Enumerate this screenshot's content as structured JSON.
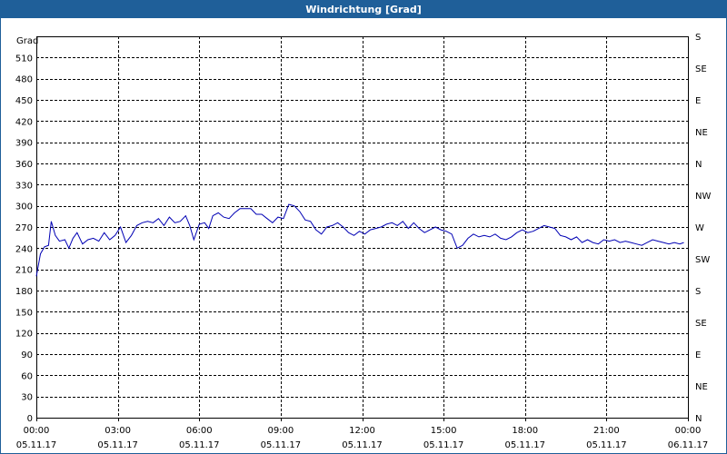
{
  "chart_data": {
    "type": "line",
    "title": "Windrichtung [Grad]",
    "ylabel": "Grad",
    "ylim": [
      0,
      540
    ],
    "yticks": [
      0,
      30,
      60,
      90,
      120,
      150,
      180,
      210,
      240,
      270,
      300,
      330,
      360,
      390,
      420,
      450,
      480,
      510
    ],
    "right_axis_labels": [
      "N",
      "NE",
      "E",
      "SE",
      "S",
      "SW",
      "W",
      "NW",
      "N",
      "NE",
      "E",
      "SE",
      "S"
    ],
    "x_tick_labels": [
      {
        "time": "00:00",
        "date": "05.11.17"
      },
      {
        "time": "03:00",
        "date": "05.11.17"
      },
      {
        "time": "06:00",
        "date": "05.11.17"
      },
      {
        "time": "09:00",
        "date": "05.11.17"
      },
      {
        "time": "12:00",
        "date": "05.11.17"
      },
      {
        "time": "15:00",
        "date": "05.11.17"
      },
      {
        "time": "18:00",
        "date": "05.11.17"
      },
      {
        "time": "21:00",
        "date": "05.11.17"
      },
      {
        "time": "00:00",
        "date": "06.11.17"
      }
    ],
    "xlim_hours": [
      0,
      24
    ],
    "grid": true,
    "series": [
      {
        "color": "#0000b4",
        "points": [
          [
            0.0,
            200
          ],
          [
            0.15,
            232
          ],
          [
            0.3,
            242
          ],
          [
            0.45,
            244
          ],
          [
            0.55,
            278
          ],
          [
            0.7,
            258
          ],
          [
            0.85,
            250
          ],
          [
            1.05,
            252
          ],
          [
            1.2,
            240
          ],
          [
            1.35,
            254
          ],
          [
            1.5,
            262
          ],
          [
            1.7,
            246
          ],
          [
            1.9,
            252
          ],
          [
            2.1,
            254
          ],
          [
            2.3,
            250
          ],
          [
            2.5,
            262
          ],
          [
            2.7,
            252
          ],
          [
            2.9,
            258
          ],
          [
            3.1,
            270
          ],
          [
            3.3,
            248
          ],
          [
            3.5,
            258
          ],
          [
            3.7,
            272
          ],
          [
            3.9,
            276
          ],
          [
            4.1,
            278
          ],
          [
            4.3,
            276
          ],
          [
            4.5,
            282
          ],
          [
            4.7,
            272
          ],
          [
            4.9,
            284
          ],
          [
            5.1,
            276
          ],
          [
            5.3,
            278
          ],
          [
            5.5,
            286
          ],
          [
            5.65,
            272
          ],
          [
            5.8,
            252
          ],
          [
            6.0,
            274
          ],
          [
            6.2,
            276
          ],
          [
            6.35,
            268
          ],
          [
            6.5,
            286
          ],
          [
            6.7,
            290
          ],
          [
            6.9,
            284
          ],
          [
            7.1,
            282
          ],
          [
            7.3,
            290
          ],
          [
            7.5,
            296
          ],
          [
            7.7,
            296
          ],
          [
            7.9,
            296
          ],
          [
            8.1,
            288
          ],
          [
            8.3,
            288
          ],
          [
            8.5,
            282
          ],
          [
            8.7,
            276
          ],
          [
            8.9,
            284
          ],
          [
            9.1,
            282
          ],
          [
            9.3,
            302
          ],
          [
            9.5,
            300
          ],
          [
            9.7,
            292
          ],
          [
            9.9,
            280
          ],
          [
            10.1,
            278
          ],
          [
            10.3,
            266
          ],
          [
            10.5,
            260
          ],
          [
            10.7,
            270
          ],
          [
            10.9,
            272
          ],
          [
            11.1,
            276
          ],
          [
            11.3,
            270
          ],
          [
            11.5,
            262
          ],
          [
            11.7,
            258
          ],
          [
            11.9,
            264
          ],
          [
            12.1,
            260
          ],
          [
            12.3,
            266
          ],
          [
            12.5,
            268
          ],
          [
            12.7,
            270
          ],
          [
            12.9,
            274
          ],
          [
            13.1,
            276
          ],
          [
            13.3,
            272
          ],
          [
            13.5,
            278
          ],
          [
            13.7,
            268
          ],
          [
            13.9,
            276
          ],
          [
            14.1,
            268
          ],
          [
            14.3,
            262
          ],
          [
            14.5,
            266
          ],
          [
            14.7,
            270
          ],
          [
            14.9,
            266
          ],
          [
            15.1,
            264
          ],
          [
            15.3,
            260
          ],
          [
            15.5,
            240
          ],
          [
            15.7,
            244
          ],
          [
            15.9,
            254
          ],
          [
            16.1,
            260
          ],
          [
            16.3,
            256
          ],
          [
            16.5,
            258
          ],
          [
            16.7,
            256
          ],
          [
            16.9,
            260
          ],
          [
            17.1,
            254
          ],
          [
            17.3,
            252
          ],
          [
            17.5,
            256
          ],
          [
            17.7,
            262
          ],
          [
            17.9,
            266
          ],
          [
            18.1,
            262
          ],
          [
            18.3,
            264
          ],
          [
            18.5,
            268
          ],
          [
            18.7,
            272
          ],
          [
            18.9,
            270
          ],
          [
            19.1,
            268
          ],
          [
            19.3,
            258
          ],
          [
            19.5,
            256
          ],
          [
            19.7,
            252
          ],
          [
            19.9,
            256
          ],
          [
            20.1,
            248
          ],
          [
            20.3,
            252
          ],
          [
            20.5,
            248
          ],
          [
            20.7,
            246
          ],
          [
            20.9,
            252
          ],
          [
            21.1,
            250
          ],
          [
            21.3,
            252
          ],
          [
            21.5,
            248
          ],
          [
            21.7,
            250
          ],
          [
            21.9,
            248
          ],
          [
            22.1,
            246
          ],
          [
            22.3,
            244
          ],
          [
            22.5,
            248
          ],
          [
            22.7,
            252
          ],
          [
            22.9,
            250
          ],
          [
            23.1,
            248
          ],
          [
            23.3,
            246
          ],
          [
            23.5,
            248
          ],
          [
            23.7,
            246
          ],
          [
            23.85,
            248
          ]
        ]
      }
    ]
  }
}
